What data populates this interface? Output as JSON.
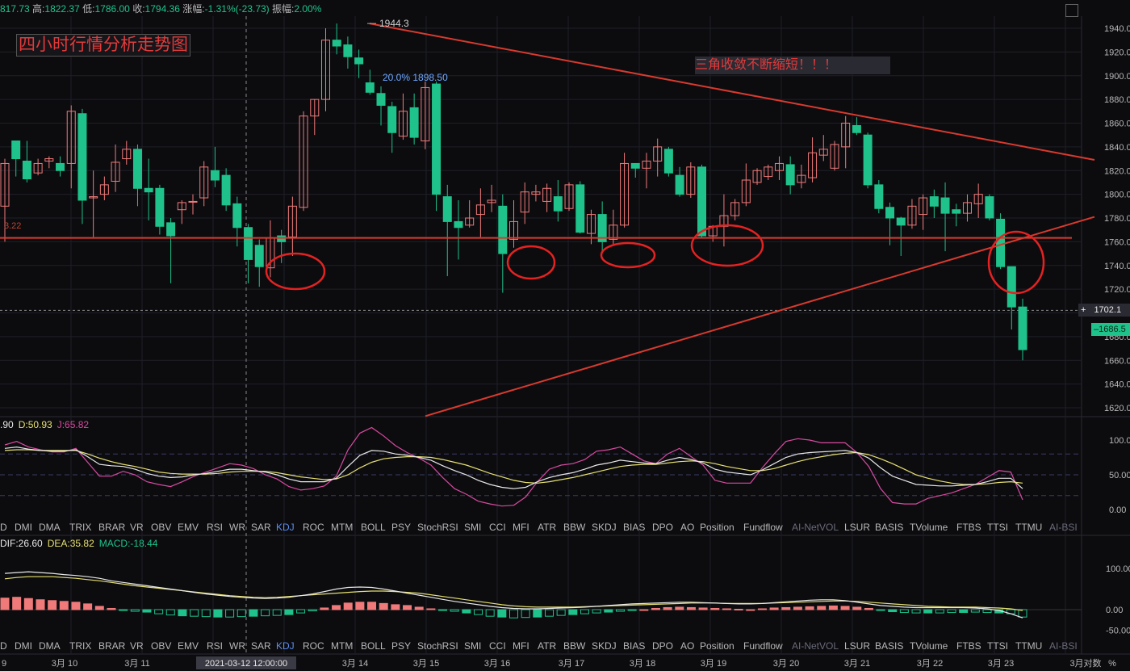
{
  "header": {
    "open": "817.73",
    "high_label": "高:",
    "high": "1822.37",
    "low_label": "低:",
    "low": "1786.00",
    "close_label": "收:",
    "close": "1794.36",
    "change_label": "涨幅:",
    "change": "-1.31%(-23.73)",
    "amp_label": "振幅:",
    "amp": "2.00%"
  },
  "title": "四小时行情分析走势图",
  "annotation": "三角收敛不断缩短！！！",
  "peak_label": "1944.3",
  "fib_label": "20.0% 1898.50",
  "left_ref": "3.22",
  "price_axis": [
    "1940.00",
    "1920.00",
    "1900.00",
    "1880.00",
    "1860.00",
    "1840.00",
    "1820.00",
    "1800.00",
    "1780.00",
    "1760.00",
    "1740.00",
    "1720.00",
    "1700.00",
    "1680.00",
    "1660.00",
    "1640.00",
    "1620.00"
  ],
  "crosshair_price": "1702.1",
  "last_price": "1686.5",
  "kdj_legend": {
    "k": ".90",
    "d": "D:50.93",
    "j": "J:65.82"
  },
  "kdj_axis": [
    "100.00",
    "50.00",
    "0.00"
  ],
  "macd_legend": {
    "dif": "DIF:26.60",
    "dea": "DEA:35.82",
    "macd": "MACD:-18.44"
  },
  "macd_axis": [
    "100.00",
    "0.00",
    "-50.00"
  ],
  "indicator_tabs": [
    "D",
    "DMI",
    "DMA",
    "TRIX",
    "BRAR",
    "VR",
    "OBV",
    "EMV",
    "RSI",
    "WR",
    "SAR",
    "KDJ",
    "ROC",
    "MTM",
    "BOLL",
    "PSY",
    "StochRSI",
    "SMI",
    "CCI",
    "MFI",
    "ATR",
    "BBW",
    "SKDJ",
    "BIAS",
    "DPO",
    "AO",
    "Position",
    "Fundflow",
    "AI-NetVOL",
    "LSUR",
    "BASIS",
    "TVolume",
    "FTBS",
    "TTSI",
    "TTMU",
    "AI-BSI"
  ],
  "date_axis": [
    "9",
    "3月 10",
    "3月 11",
    "2021-03-12 12:00:00",
    "3月 14",
    "3月 15",
    "3月 16",
    "3月 17",
    "3月 18",
    "3月 19",
    "3月 20",
    "3月 21",
    "3月 22",
    "3月 23",
    "3月对数",
    "%"
  ],
  "colors": {
    "up": "#f07a7a",
    "down": "#1fc28a",
    "trend": "#d83a2e",
    "k": "#e8e8e8",
    "d": "#e6e070",
    "j": "#d84aa0",
    "text": "#b8b8b8",
    "bg": "#0c0c0f",
    "grid": "#1e1e28"
  },
  "chart_data": {
    "type": "candlestick",
    "title": "四小时行情分析走势图",
    "ylim": [
      1610,
      1950
    ],
    "candles": [
      [
        1790,
        1826,
        1760,
        1830
      ],
      [
        1845,
        1830,
        1815,
        1845
      ],
      [
        1828,
        1813,
        1810,
        1845
      ],
      [
        1818,
        1826,
        1816,
        1830
      ],
      [
        1828,
        1830,
        1822,
        1832
      ],
      [
        1826,
        1820,
        1815,
        1832
      ],
      [
        1826,
        1870,
        1805,
        1875
      ],
      [
        1868,
        1795,
        1775,
        1872
      ],
      [
        1797,
        1798,
        1764,
        1820
      ],
      [
        1800,
        1808,
        1795,
        1815
      ],
      [
        1811,
        1827,
        1802,
        1842
      ],
      [
        1830,
        1838,
        1825,
        1845
      ],
      [
        1838,
        1805,
        1790,
        1842
      ],
      [
        1805,
        1802,
        1778,
        1830
      ],
      [
        1805,
        1773,
        1766,
        1808
      ],
      [
        1776,
        1765,
        1725,
        1780
      ],
      [
        1787,
        1793,
        1775,
        1795
      ],
      [
        1794,
        1794,
        1783,
        1800
      ],
      [
        1797,
        1823,
        1790,
        1828
      ],
      [
        1820,
        1812,
        1806,
        1840
      ],
      [
        1816,
        1791,
        1786,
        1822
      ],
      [
        1792,
        1772,
        1756,
        1798
      ],
      [
        1772,
        1745,
        1725,
        1775
      ],
      [
        1757,
        1739,
        1722,
        1762
      ],
      [
        1738,
        1763,
        1730,
        1778
      ],
      [
        1765,
        1760,
        1742,
        1770
      ],
      [
        1764,
        1790,
        1748,
        1798
      ],
      [
        1789,
        1866,
        1786,
        1870
      ],
      [
        1866,
        1880,
        1850,
        1880
      ],
      [
        1880,
        1930,
        1870,
        1940
      ],
      [
        1930,
        1925,
        1918,
        1944
      ],
      [
        1926,
        1916,
        1906,
        1933
      ],
      [
        1915,
        1910,
        1898,
        1922
      ],
      [
        1894,
        1886,
        1884,
        1905
      ],
      [
        1885,
        1875,
        1858,
        1891
      ],
      [
        1874,
        1852,
        1835,
        1878
      ],
      [
        1849,
        1870,
        1846,
        1885
      ],
      [
        1873,
        1848,
        1842,
        1885
      ],
      [
        1845,
        1890,
        1838,
        1895
      ],
      [
        1893,
        1800,
        1786,
        1895
      ],
      [
        1798,
        1777,
        1731,
        1808
      ],
      [
        1777,
        1772,
        1745,
        1795
      ],
      [
        1774,
        1780,
        1772,
        1795
      ],
      [
        1783,
        1791,
        1764,
        1805
      ],
      [
        1793,
        1795,
        1785,
        1808
      ],
      [
        1790,
        1750,
        1717,
        1800
      ],
      [
        1762,
        1777,
        1755,
        1795
      ],
      [
        1785,
        1802,
        1775,
        1810
      ],
      [
        1800,
        1802,
        1794,
        1808
      ],
      [
        1794,
        1805,
        1785,
        1809
      ],
      [
        1798,
        1786,
        1777,
        1812
      ],
      [
        1788,
        1808,
        1786,
        1810
      ],
      [
        1808,
        1768,
        1767,
        1811
      ],
      [
        1767,
        1783,
        1758,
        1787
      ],
      [
        1783,
        1760,
        1752,
        1794
      ],
      [
        1762,
        1774,
        1758,
        1787
      ],
      [
        1774,
        1826,
        1772,
        1835
      ],
      [
        1826,
        1822,
        1814,
        1826
      ],
      [
        1822,
        1828,
        1805,
        1835
      ],
      [
        1828,
        1840,
        1815,
        1847
      ],
      [
        1838,
        1818,
        1815,
        1840
      ],
      [
        1816,
        1800,
        1798,
        1823
      ],
      [
        1800,
        1823,
        1797,
        1827
      ],
      [
        1823,
        1765,
        1763,
        1825
      ],
      [
        1765,
        1773,
        1760,
        1774
      ],
      [
        1773,
        1782,
        1756,
        1800
      ],
      [
        1782,
        1793,
        1778,
        1796
      ],
      [
        1793,
        1812,
        1790,
        1826
      ],
      [
        1810,
        1820,
        1808,
        1822
      ],
      [
        1815,
        1823,
        1812,
        1825
      ],
      [
        1820,
        1826,
        1812,
        1832
      ],
      [
        1825,
        1808,
        1800,
        1832
      ],
      [
        1810,
        1816,
        1805,
        1825
      ],
      [
        1814,
        1835,
        1810,
        1848
      ],
      [
        1833,
        1838,
        1828,
        1850
      ],
      [
        1822,
        1842,
        1820,
        1845
      ],
      [
        1840,
        1860,
        1822,
        1866
      ],
      [
        1858,
        1852,
        1850,
        1865
      ],
      [
        1850,
        1808,
        1805,
        1852
      ],
      [
        1808,
        1788,
        1784,
        1812
      ],
      [
        1789,
        1780,
        1757,
        1793
      ],
      [
        1780,
        1774,
        1748,
        1781
      ],
      [
        1774,
        1790,
        1771,
        1796
      ],
      [
        1783,
        1797,
        1770,
        1800
      ],
      [
        1798,
        1790,
        1780,
        1804
      ],
      [
        1797,
        1784,
        1752,
        1810
      ],
      [
        1787,
        1784,
        1773,
        1792
      ],
      [
        1784,
        1793,
        1777,
        1800
      ],
      [
        1792,
        1800,
        1780,
        1809
      ],
      [
        1798,
        1780,
        1778,
        1800
      ],
      [
        1779,
        1739,
        1737,
        1784
      ],
      [
        1739,
        1705,
        1686,
        1738
      ],
      [
        1705,
        1669,
        1660,
        1712
      ]
    ],
    "kdj": {
      "k": [
        88,
        90,
        87,
        85,
        84,
        84,
        86,
        76,
        65,
        63,
        62,
        58,
        52,
        48,
        46,
        47,
        50,
        52,
        55,
        58,
        58,
        56,
        54,
        50,
        44,
        40,
        40,
        40,
        45,
        62,
        78,
        85,
        84,
        80,
        78,
        75,
        71,
        63,
        56,
        50,
        42,
        36,
        32,
        30,
        32,
        40,
        46,
        50,
        53,
        58,
        64,
        67,
        71,
        69,
        67,
        66,
        71,
        75,
        72,
        67,
        58,
        54,
        52,
        50,
        57,
        66,
        75,
        80,
        82,
        83,
        84,
        85,
        82,
        74,
        60,
        48,
        42,
        36,
        35,
        34,
        34,
        35,
        36,
        40,
        45,
        45,
        30
      ],
      "d": [
        85,
        86,
        86,
        85,
        85,
        85,
        85,
        80,
        74,
        69,
        65,
        62,
        58,
        54,
        52,
        51,
        51,
        51,
        52,
        54,
        55,
        55,
        55,
        53,
        50,
        47,
        45,
        43,
        44,
        50,
        60,
        68,
        73,
        75,
        76,
        76,
        75,
        72,
        68,
        64,
        58,
        52,
        47,
        42,
        39,
        38,
        40,
        43,
        46,
        50,
        54,
        58,
        62,
        64,
        65,
        65,
        67,
        69,
        70,
        69,
        66,
        62,
        59,
        56,
        56,
        59,
        64,
        69,
        73,
        76,
        79,
        81,
        82,
        79,
        73,
        66,
        58,
        50,
        45,
        41,
        38,
        36,
        36,
        37,
        39,
        40,
        38
      ],
      "j": [
        93,
        98,
        90,
        86,
        83,
        83,
        88,
        68,
        48,
        48,
        55,
        50,
        40,
        36,
        33,
        40,
        48,
        54,
        60,
        66,
        64,
        59,
        50,
        44,
        33,
        28,
        30,
        34,
        48,
        86,
        110,
        118,
        106,
        92,
        82,
        74,
        64,
        46,
        30,
        22,
        12,
        8,
        5,
        6,
        18,
        40,
        58,
        64,
        66,
        72,
        84,
        86,
        90,
        80,
        70,
        66,
        80,
        88,
        76,
        64,
        42,
        38,
        38,
        38,
        60,
        80,
        98,
        102,
        100,
        96,
        96,
        96,
        82,
        62,
        30,
        10,
        8,
        8,
        16,
        20,
        24,
        30,
        36,
        46,
        56,
        54,
        14
      ]
    },
    "macd": {
      "hist": [
        28,
        30,
        27,
        24,
        22,
        20,
        18,
        14,
        8,
        3,
        -2,
        -4,
        -6,
        -10,
        -13,
        -15,
        -16,
        -17,
        -18,
        -18,
        -17,
        -16,
        -15,
        -14,
        -12,
        -8,
        -3,
        4,
        10,
        16,
        18,
        18,
        15,
        12,
        10,
        6,
        2,
        -1,
        -4,
        -8,
        -12,
        -16,
        -18,
        -20,
        -19,
        -18,
        -16,
        -14,
        -12,
        -10,
        -8,
        -6,
        -4,
        -2,
        0,
        3,
        5,
        6,
        5,
        4,
        3,
        2,
        1,
        0,
        2,
        4,
        5,
        6,
        7,
        8,
        9,
        8,
        6,
        3,
        -2,
        -5,
        -7,
        -8,
        -8,
        -8,
        -7,
        -7,
        -6,
        -7,
        -8,
        -10,
        -18
      ],
      "dif": [
        88,
        90,
        92,
        90,
        88,
        85,
        83,
        80,
        76,
        70,
        66,
        62,
        58,
        54,
        50,
        46,
        42,
        38,
        35,
        32,
        30,
        28,
        27,
        28,
        30,
        34,
        38,
        44,
        50,
        54,
        55,
        54,
        50,
        45,
        40,
        35,
        30,
        25,
        20,
        16,
        12,
        8,
        5,
        3,
        2,
        2,
        3,
        4,
        5,
        6,
        8,
        10,
        12,
        14,
        15,
        16,
        17,
        18,
        18,
        17,
        16,
        15,
        14,
        14,
        15,
        17,
        19,
        21,
        23,
        24,
        24,
        22,
        18,
        14,
        10,
        8,
        6,
        5,
        5,
        5,
        5,
        5,
        4,
        2,
        -2,
        -10,
        -20
      ],
      "dea": [
        75,
        78,
        80,
        80,
        80,
        78,
        76,
        73,
        70,
        66,
        62,
        58,
        55,
        52,
        49,
        46,
        43,
        40,
        37,
        34,
        32,
        30,
        29,
        30,
        32,
        34,
        36,
        38,
        40,
        42,
        44,
        45,
        45,
        44,
        42,
        40,
        36,
        32,
        28,
        24,
        20,
        16,
        12,
        9,
        7,
        6,
        6,
        6,
        6,
        7,
        8,
        9,
        10,
        11,
        12,
        13,
        14,
        15,
        16,
        16,
        16,
        15,
        15,
        15,
        15,
        16,
        17,
        18,
        19,
        20,
        21,
        21,
        20,
        18,
        16,
        14,
        12,
        10,
        8,
        7,
        6,
        6,
        6,
        5,
        4,
        2,
        -2
      ]
    }
  }
}
